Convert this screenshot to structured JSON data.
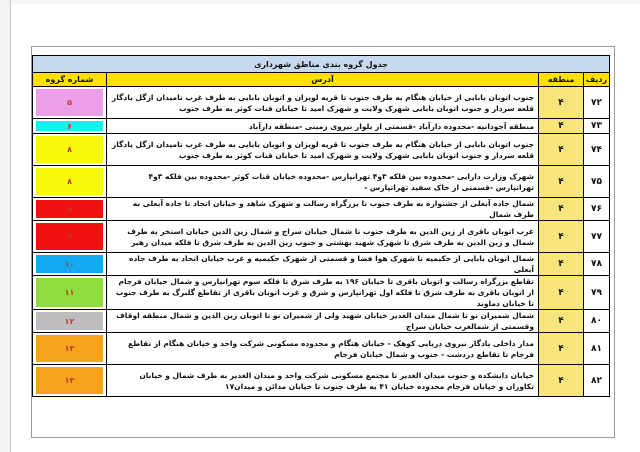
{
  "table": {
    "title": "جدول گروه بندی مناطق شهرداری",
    "headers": {
      "row_no": "ردیف",
      "region": "منطقه",
      "address": "آدرس",
      "group_no": "شماره گروه"
    },
    "rows": [
      {
        "row_no": "۷۲",
        "region": "۴",
        "address": "جنوب اتوبان بابایی از خیابان هنگام به طرف جنوب تا قریه لویزان و اتوبان بابایی به طرف غرب تامیدان ازگل یادگار قلعه سردار و جنوب اتوبان بابایی شهرک ولایت و شهرک امید تا خیابان قنات کوثر به طرف جنوب",
        "group_no": "۵",
        "group_color": "#ee9ee8",
        "group_text_color": "#c0392b"
      },
      {
        "row_no": "۷۳",
        "region": "۴",
        "address": "منطقه آجودانیه -محدوده دارآباد -قسمتی از بلوار نیروی زمینی -منطقه دارآباد",
        "group_no": "۶",
        "group_color": "#19f0ec",
        "group_text_color": "#c0392b"
      },
      {
        "row_no": "۷۴",
        "region": "۴",
        "address": "جنوب اتوبان بابایی از خیابان هنگام به طرف جنوب تا قریه لویزان و اتوبان بابایی به طرف غرب تامیدان ازگل یادگار قلعه سردار و جنوب اتوبان بابایی شهرک ولایت و شهرک امید تا خیابان قنات کوثر به طرف جنوب",
        "group_no": "۸",
        "group_color": "#f7f70a",
        "group_text_color": "#c0392b"
      },
      {
        "row_no": "۷۵",
        "region": "۴",
        "address": "شهرک وزارت دارایی -محدوده بین فلکه ۳و۴ تهرانپارس -محدوده خیابان قنات کوثر -محدوده بین فلکه ۳و۴ تهرانپارس -قسمتی از خاک سفید تهرانپارس -",
        "group_no": "۸",
        "group_color": "#f7f70a",
        "group_text_color": "#c0392b"
      },
      {
        "row_no": "۷۶",
        "region": "۴",
        "address": "شمال جاده آبعلی از جشنواره به طرف جنوب تا بزرگراه رسالت و شهرک شاهد و خیابان اتحاد تا جاده آبعلی به طرف شمال",
        "group_no": "۹",
        "group_color": "#f0120f",
        "group_text_color": "#c0392b"
      },
      {
        "row_no": "۷۷",
        "region": "۴",
        "address": "غرب اتوبان باقری از زین الدین به طرف جنوب تا شمال خیابان سراج و شمال زین الدین خیابان استخر به طرف شمال و زین الدین به طرف شرق تا شهرک شهید بهشتی و جنوب زین الدین به طرف شرق تا فلکه میدان رهبر",
        "group_no": "۹",
        "group_color": "#f0120f",
        "group_text_color": "#c0392b"
      },
      {
        "row_no": "۷۸",
        "region": "۴",
        "address": "شمال اتوبان بابایی از حکیمیه تا شهرک هوا فضا و قسمتی از شهرک حکیمیه و غرب خیابان اتحاد به طرف جاده آبعلی",
        "group_no": "۱۰",
        "group_color": "#14a8f0",
        "group_text_color": "#c0392b"
      },
      {
        "row_no": "۷۹",
        "region": "۴",
        "address": "تقاطع بزرگراه رسالت و اتوبان باقری تا خیابان ۱۹۶ به طرف شرق تا فلکه سوم تهرانپارس و شمال خیابان فرجام از اتوبان باقری به طرف شرق تا فلکه اول تهرانپارس و شرق و غرب اتوبان باقری از تقاطع گلبرگ به طرف جنوب تا خیابان دماوند",
        "group_no": "۱۱",
        "group_color": "#8fdc3c",
        "group_text_color": "#c0392b"
      },
      {
        "row_no": "۸۰",
        "region": "۴",
        "address": "شمال شمیران نو تا شمال میدان الغدیر خیابان شهید ولی از شمیران نو تا اتوبان زین الدین و شمال منطقه اوقاف وقسمتی از شمالغرب خیابان سراج",
        "group_no": "۱۲",
        "group_color": "#bdbdbd",
        "group_text_color": "#c0392b"
      },
      {
        "row_no": "۸۱",
        "region": "۴",
        "address": "مدار داخلی یادگار نیروی دریایی کوهک - خیابان هنگام و محدوده مسکونی شرکت واحد و خیابان هنگام از تقاطع فرجام تا تقاطع دردشت - جنوب و شمال خیابان فرجام",
        "group_no": "۱۳",
        "group_color": "#f6a21e",
        "group_text_color": "#c0392b"
      },
      {
        "row_no": "۸۲",
        "region": "۴",
        "address": "خیابان دانشکده و جنوب میدان الغدیر تا مجتمع مسکونی شرکت واحد و میدان الغدیر به طرف شمال و خیابان تکاوران و خیابان فرجام محدوده خیابان ۴۱ به طرف جنوب تا خیابان مدائن و میدان۱۷",
        "group_no": "۱۳",
        "group_color": "#f6a21e",
        "group_text_color": "#c0392b"
      }
    ]
  }
}
